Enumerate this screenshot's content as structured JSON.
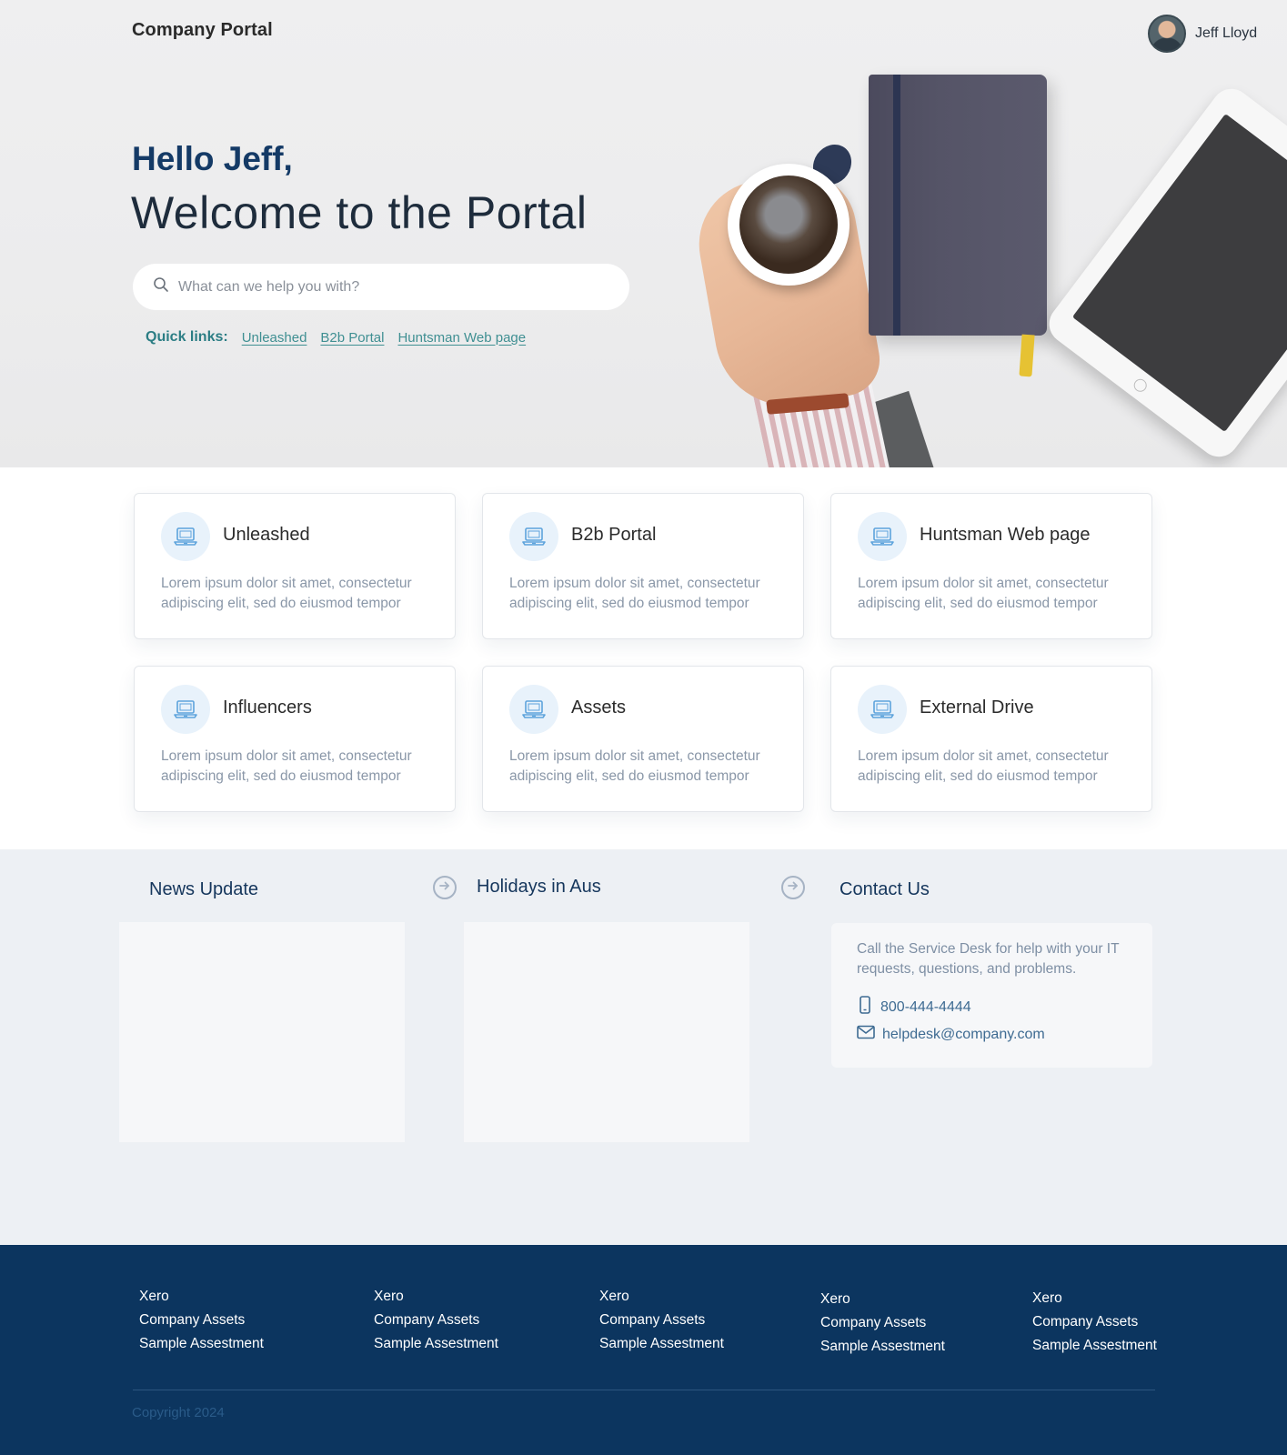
{
  "header": {
    "brand": "Company Portal",
    "user_name": "Jeff Lloyd"
  },
  "hero": {
    "greeting": "Hello Jeff,",
    "welcome": "Welcome to the Portal",
    "search": {
      "placeholder": "What can we help you with?",
      "value": ""
    },
    "quick_links_label": "Quick links:",
    "quick_links": [
      "Unleashed",
      "B2b Portal",
      "Huntsman Web page"
    ]
  },
  "cards": [
    {
      "title": "Unleashed",
      "description": "Lorem ipsum dolor sit amet, consectetur adipiscing elit, sed do eiusmod tempor",
      "icon": "laptop-icon"
    },
    {
      "title": "B2b Portal",
      "description": "Lorem ipsum dolor sit amet, consectetur adipiscing elit, sed do eiusmod tempor",
      "icon": "laptop-icon"
    },
    {
      "title": "Huntsman Web page",
      "description": "Lorem ipsum dolor sit amet, consectetur adipiscing elit, sed do eiusmod tempor",
      "icon": "laptop-icon"
    },
    {
      "title": "Influencers",
      "description": "Lorem ipsum dolor sit amet, consectetur adipiscing elit, sed do eiusmod tempor",
      "icon": "laptop-icon"
    },
    {
      "title": "Assets",
      "description": "Lorem ipsum dolor sit amet, consectetur adipiscing elit, sed do eiusmod tempor",
      "icon": "laptop-icon"
    },
    {
      "title": "External Drive",
      "description": "Lorem ipsum dolor sit amet, consectetur adipiscing elit, sed do eiusmod tempor",
      "icon": "laptop-icon"
    }
  ],
  "info": {
    "news_title": "News Update",
    "holidays_title": "Holidays in Aus",
    "contact": {
      "title": "Contact Us",
      "text": "Call the Service Desk for help with your IT requests, questions, and problems.",
      "phone": "800-444-4444",
      "email": "helpdesk@company.com"
    }
  },
  "footer": {
    "columns": [
      [
        "Xero",
        "Company Assets",
        "Sample Assestment"
      ],
      [
        "Xero",
        "Company Assets",
        "Sample Assestment"
      ],
      [
        "Xero",
        "Company Assets",
        "Sample Assestment"
      ],
      [
        "Xero",
        "Company Assets",
        "Sample Assestment"
      ],
      [
        "Xero",
        "Company Assets",
        "Sample Assestment"
      ]
    ],
    "copyright": "Copyright 2024"
  },
  "colors": {
    "brand_navy": "#143a66",
    "footer_bg": "#0c355f",
    "quick_link_teal": "#3f8f92",
    "icon_blue": "#5da3dc"
  }
}
